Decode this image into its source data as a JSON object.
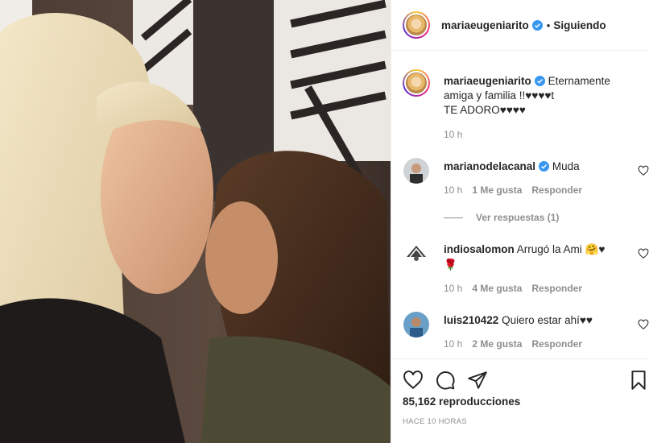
{
  "post": {
    "author": "mariaeugeniarito",
    "follow_status": "Siguiendo",
    "separator": "•",
    "more_label": "•••"
  },
  "caption": {
    "username": "mariaeugeniarito",
    "line1": "Eternamente",
    "line2": "amiga y familia !!♥♥♥♥t",
    "line3": "TE ADORO♥♥♥♥",
    "time": "10 h"
  },
  "comments": [
    {
      "username": "marianodelacanal",
      "verified": true,
      "text": "Muda",
      "time": "10 h",
      "likes": "1 Me gusta",
      "reply": "Responder",
      "replies_link": "Ver respuestas (1)"
    },
    {
      "username": "indiosalomon",
      "verified": false,
      "text": "Arrugó la Ami 🤗♥",
      "emoji_line2": "🌹",
      "time": "10 h",
      "likes": "4 Me gusta",
      "reply": "Responder"
    },
    {
      "username": "luis210422",
      "verified": false,
      "text": "Quiero estar ahí♥♥",
      "time": "10 h",
      "likes": "2 Me gusta",
      "reply": "Responder"
    }
  ],
  "stats": {
    "views": "85,162 reproducciones",
    "posted": "HACE 10 HORAS"
  },
  "icons": [
    "heart-icon",
    "comment-icon",
    "share-icon",
    "bookmark-icon",
    "verified-icon"
  ],
  "colors": {
    "verified": "#3897f0",
    "muted": "#8e8e8e",
    "text": "#262626"
  }
}
